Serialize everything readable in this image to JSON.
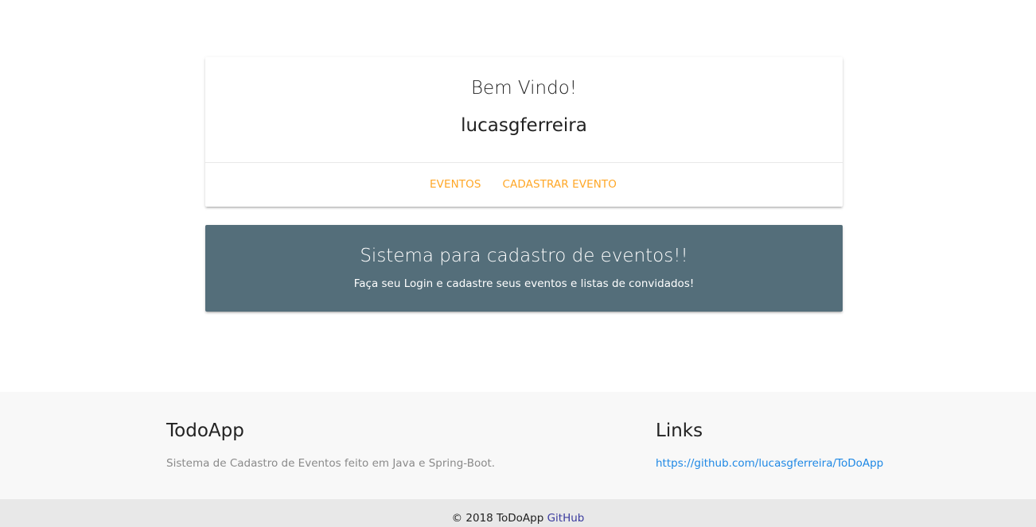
{
  "welcome": {
    "title": "Bem Vindo!",
    "username": "lucasgferreira",
    "actions": [
      {
        "label": "EVENTOS"
      },
      {
        "label": "CADASTRAR EVENTO"
      }
    ]
  },
  "banner": {
    "title": "Sistema para cadastro de eventos!!",
    "subtitle": "Faça seu Login e cadastre seus eventos e listas de convidados!"
  },
  "footer": {
    "about": {
      "heading": "TodoApp",
      "text": "Sistema de Cadastro de Eventos feito em Java e Spring-Boot."
    },
    "links": {
      "heading": "Links",
      "items": [
        {
          "label": "https://github.com/lucasgferreira/ToDoApp"
        }
      ]
    }
  },
  "copyright": {
    "text": "© 2018 ToDoApp",
    "link_label": "GitHub"
  },
  "colors": {
    "accent": "#ffa726",
    "banner_bg": "#546e7a",
    "link": "#1e88e5"
  }
}
